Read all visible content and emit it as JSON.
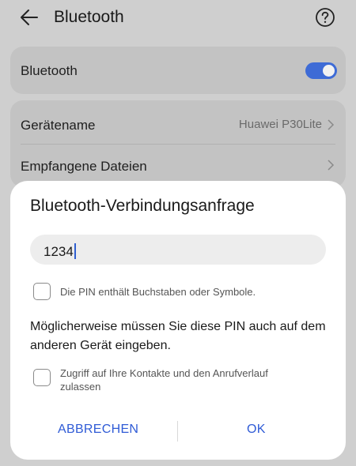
{
  "header": {
    "title": "Bluetooth",
    "back_icon": "arrow-left-icon",
    "help_icon": "question-circle-icon"
  },
  "bluetooth_card": {
    "label": "Bluetooth",
    "toggle_on": true,
    "toggle_color": "#3e6bd6"
  },
  "info_card": {
    "device_name_label": "Gerätename",
    "device_name_value": "Huawei P30Lite",
    "received_files_label": "Empfangene Dateien"
  },
  "dialog": {
    "title": "Bluetooth-Verbindungsanfrage",
    "pin_value": "1234",
    "checkbox1_label": "Die PIN enthält Buchstaben oder Symbole.",
    "checkbox1_checked": false,
    "info_text": "Möglicherweise müssen Sie diese PIN auch auf dem anderen Gerät eingeben.",
    "checkbox2_label": "Zugriff auf Ihre Kontakte und den Anrufverlauf zulassen",
    "checkbox2_checked": false,
    "cancel_label": "ABBRECHEN",
    "ok_label": "OK",
    "accent_color": "#2f5bd6"
  }
}
